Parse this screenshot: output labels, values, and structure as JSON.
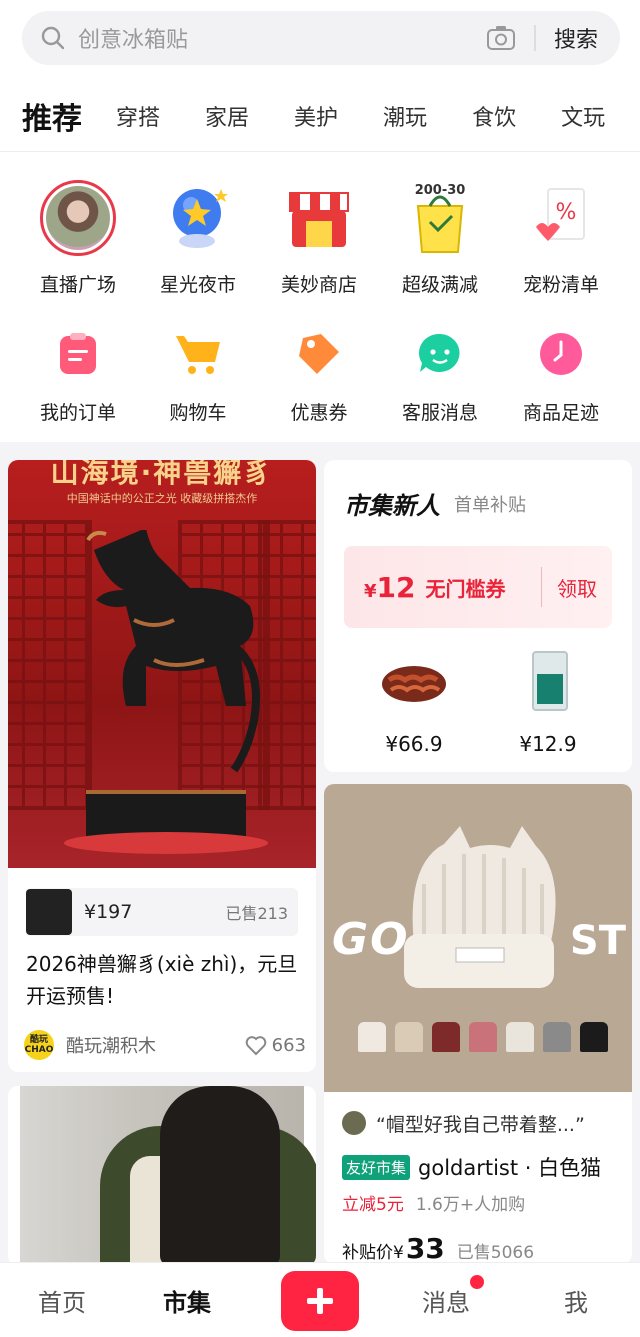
{
  "search": {
    "placeholder": "创意冰箱贴",
    "button": "搜索"
  },
  "tabs": [
    "推荐",
    "穿搭",
    "家居",
    "美护",
    "潮玩",
    "食饮",
    "文玩"
  ],
  "shortcuts_row1": [
    "直播广场",
    "星光夜市",
    "美妙商店",
    "超级满减",
    "宠粉清单"
  ],
  "shortcuts_row2": [
    "我的订单",
    "购物车",
    "优惠券",
    "客服消息",
    "商品足迹"
  ],
  "badge_text": "200-30",
  "poster": {
    "title": "山海境·神兽獬豸",
    "subtitle": "中国神话中的公正之光 收藏级拼搭杰作"
  },
  "product1": {
    "price": "¥197",
    "sold": "已售213",
    "title": "2026神兽獬豸(xiè zhì)，元旦开运预售!",
    "shop": "酷玩潮积木",
    "shop_logo": "酷玩 CHAO",
    "likes": "663"
  },
  "new_user": {
    "title": "市集新人",
    "subtitle": "首单补贴",
    "coupon_amount": "12",
    "coupon_currency": "¥",
    "coupon_desc": "无门槛券",
    "coupon_action": "领取",
    "items": [
      {
        "price": "¥66.9"
      },
      {
        "price": "¥12.9"
      }
    ]
  },
  "product2": {
    "bg_text_left": "GO",
    "bg_text_right": "ST",
    "review": "“帽型好我自己带着整...”",
    "tag": "友好市集",
    "name": "goldartist · 白色猫",
    "promo": "立减5元",
    "count": "1.6万+人加购",
    "price_label": "补贴价¥",
    "price": "33",
    "sold": "已售5066"
  },
  "nav": {
    "home": "首页",
    "market": "市集",
    "messages": "消息",
    "me": "我"
  },
  "colors": {
    "accent": "#ff2442",
    "red": "#e8233a",
    "tag_green": "#0fa27a"
  }
}
